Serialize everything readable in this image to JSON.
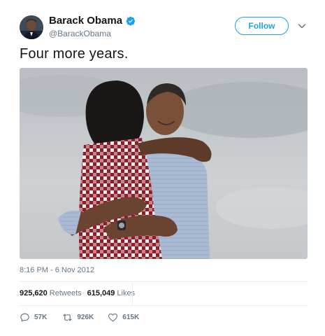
{
  "user": {
    "name": "Barack Obama",
    "handle": "@BarackObama",
    "verified": true,
    "avatar_icon": "profile-photo"
  },
  "follow_button": {
    "label": "Follow"
  },
  "tweet": {
    "text": "Four more years.",
    "timestamp": "8:16 PM - 6 Nov 2012"
  },
  "stats": {
    "retweets_count": "925,620",
    "retweets_label": "Retweets",
    "likes_count": "615,049",
    "likes_label": "Likes"
  },
  "actions": {
    "reply_count": "57K",
    "retweet_count": "926K",
    "like_count": "615K"
  },
  "colors": {
    "accent": "#1da1f2",
    "text": "#14171a",
    "secondary": "#657786",
    "divider": "#e6ecf0"
  }
}
